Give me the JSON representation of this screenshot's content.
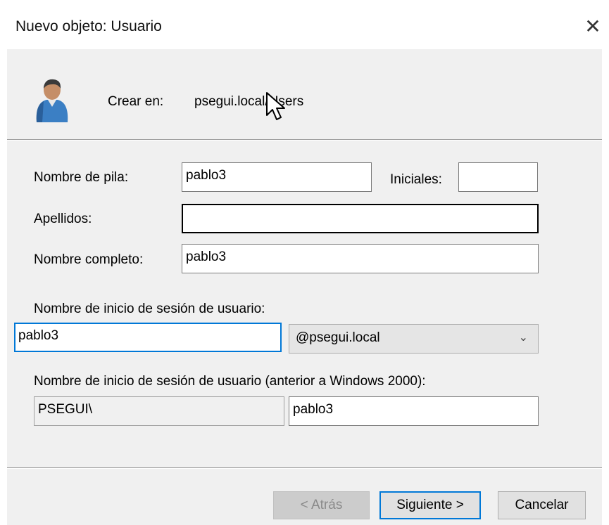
{
  "window": {
    "title": "Nuevo objeto: Usuario",
    "close_glyph": "✕"
  },
  "header": {
    "create_in_label": "Crear en:",
    "create_in_path": "psegui.local/Users",
    "icon": "user-icon"
  },
  "form": {
    "first_name": {
      "label": "Nombre de pila:",
      "value": "pablo3"
    },
    "initials": {
      "label": "Iniciales:",
      "value": ""
    },
    "last_name": {
      "label": "Apellidos:",
      "value": ""
    },
    "full_name": {
      "label": "Nombre completo:",
      "value": "pablo3"
    },
    "logon_name": {
      "label": "Nombre de inicio de sesión de usuario:",
      "value": "pablo3",
      "domain_selected": "@psegui.local"
    },
    "pre2000": {
      "label": "Nombre de inicio de sesión de usuario (anterior a Windows 2000):",
      "domain": "PSEGUI\\",
      "value": "pablo3"
    }
  },
  "buttons": {
    "back": "< Atrás",
    "next": "Siguiente >",
    "cancel": "Cancelar"
  },
  "colors": {
    "focus": "#0078d7",
    "dialog_bg": "#f0f0f0"
  }
}
